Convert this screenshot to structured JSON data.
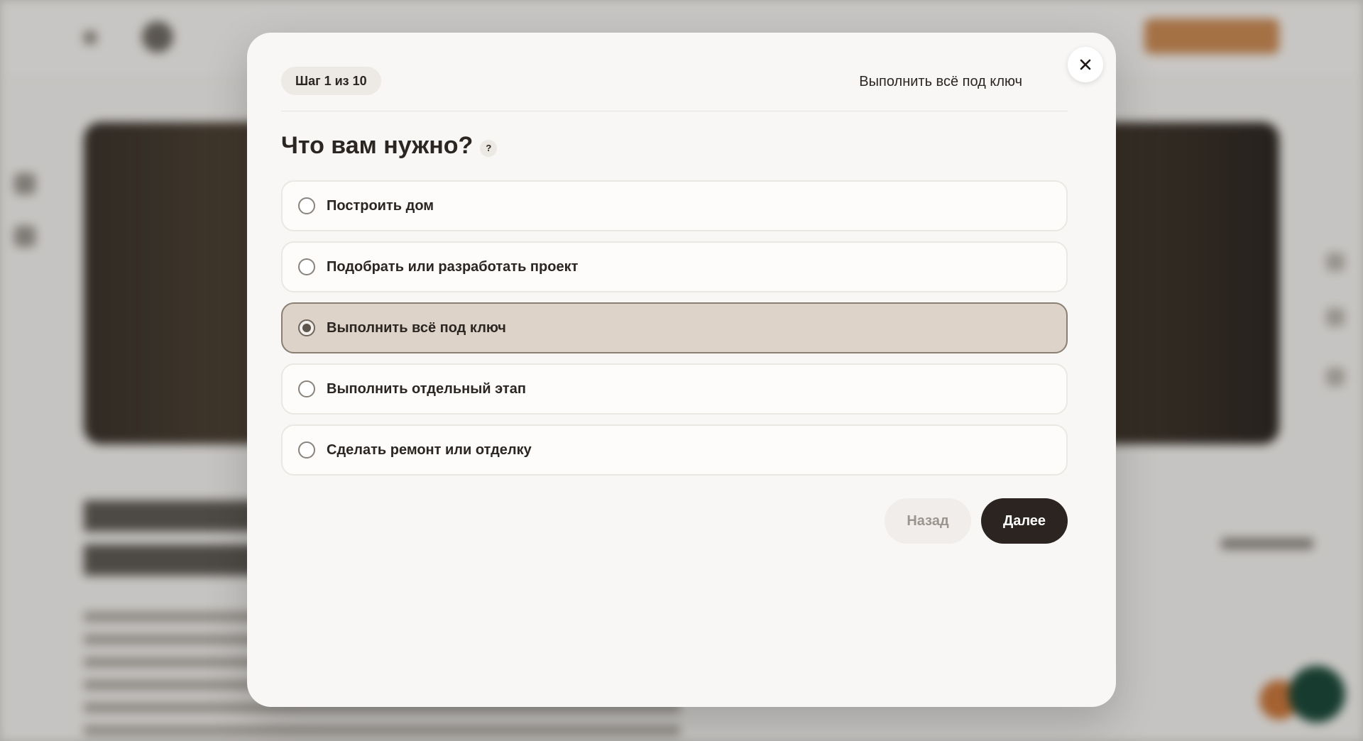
{
  "modal": {
    "step_label": "Шаг 1 из 10",
    "summary": "Выполнить всё под ключ",
    "question": "Что вам нужно?",
    "help_icon_label": "?",
    "close_icon": "close-icon",
    "options": [
      {
        "label": "Построить дом",
        "selected": false
      },
      {
        "label": "Подобрать или разработать проект",
        "selected": false
      },
      {
        "label": "Выполнить всё под ключ",
        "selected": true
      },
      {
        "label": "Выполнить отдельный этап",
        "selected": false
      },
      {
        "label": "Сделать ремонт или отделку",
        "selected": false
      }
    ],
    "back_label": "Назад",
    "next_label": "Далее"
  },
  "colors": {
    "accent_dark": "#2b2420",
    "selected_bg": "#ddd3c9",
    "modal_bg": "#f8f7f5"
  }
}
